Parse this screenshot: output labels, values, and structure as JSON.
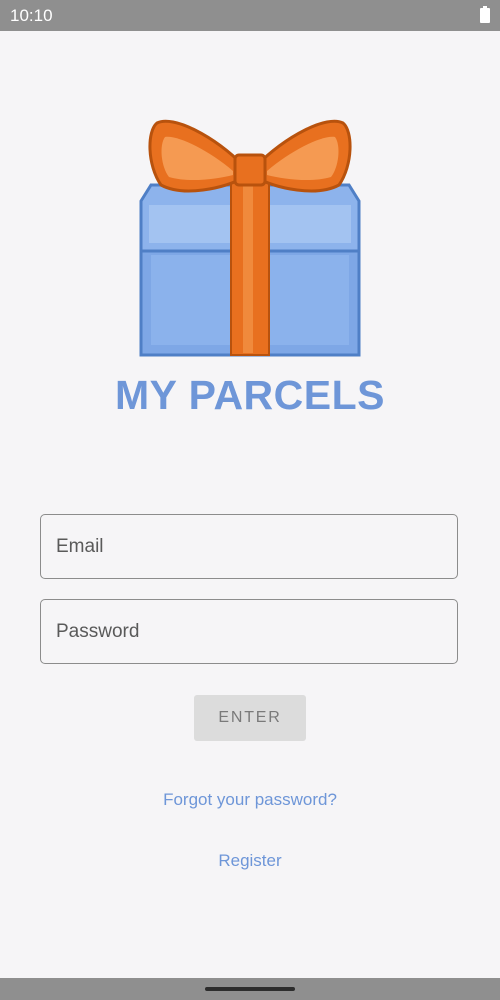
{
  "status_bar": {
    "time": "10:10"
  },
  "app": {
    "title": "MY PARCELS"
  },
  "form": {
    "email_placeholder": "Email",
    "password_placeholder": "Password",
    "enter_label": "ENTER"
  },
  "links": {
    "forgot_password": "Forgot your password?",
    "register": "Register"
  },
  "icons": {
    "logo": "gift-box-icon",
    "battery": "battery-icon"
  },
  "colors": {
    "accent": "#6e96d8",
    "ribbon": "#e8701f",
    "box": "#7ea7e6",
    "button_disabled": "#dcdcdc"
  }
}
